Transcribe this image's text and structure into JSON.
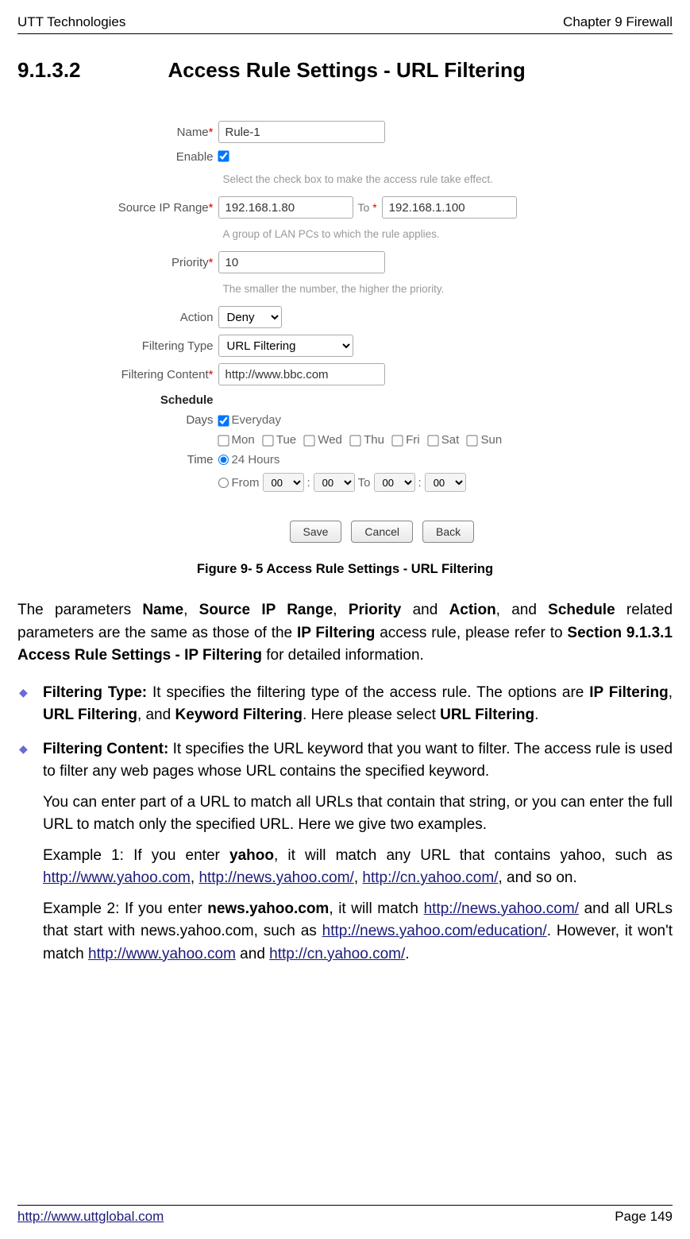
{
  "header": {
    "left": "UTT Technologies",
    "right": "Chapter 9 Firewall"
  },
  "section": {
    "num": "9.1.3.2",
    "title": "Access Rule Settings - URL Filtering"
  },
  "form": {
    "name_label": "Name",
    "name_value": "Rule-1",
    "enable_label": "Enable",
    "enable_hint": "Select the check box to make the access rule take effect.",
    "srcip_label": "Source IP Range",
    "srcip_from": "192.168.1.80",
    "srcip_to_label": "To",
    "srcip_to": "192.168.1.100",
    "srcip_hint": "A group of LAN PCs to which the rule applies.",
    "priority_label": "Priority",
    "priority_value": "10",
    "priority_hint": "The smaller the number, the higher the priority.",
    "action_label": "Action",
    "action_value": "Deny",
    "ftype_label": "Filtering Type",
    "ftype_value": "URL Filtering",
    "fcontent_label": "Filtering Content",
    "fcontent_value": "http://www.bbc.com",
    "schedule_label": "Schedule",
    "days_label": "Days",
    "day_every": "Everyday",
    "day_mon": "Mon",
    "day_tue": "Tue",
    "day_wed": "Wed",
    "day_thu": "Thu",
    "day_fri": "Fri",
    "day_sat": "Sat",
    "day_sun": "Sun",
    "time_label": "Time",
    "time_24": "24 Hours",
    "time_from": "From",
    "time_to": "To",
    "time_h1": "00",
    "time_m1": "00",
    "time_h2": "00",
    "time_m2": "00",
    "btn_save": "Save",
    "btn_cancel": "Cancel",
    "btn_back": "Back"
  },
  "figure_caption": "Figure 9- 5 Access Rule Settings - URL Filtering",
  "body": {
    "intro_1": "The parameters ",
    "intro_name": "Name",
    "intro_2": ", ",
    "intro_src": "Source IP Range",
    "intro_3": ", ",
    "intro_pri": "Priority",
    "intro_4": " and ",
    "intro_act": "Action",
    "intro_5": ", and ",
    "intro_sch": "Schedule",
    "intro_6": " related parameters are the same as those of the ",
    "intro_ipf": "IP Filtering",
    "intro_7": " access rule, please refer to ",
    "intro_sec": "Section 9.1.3.1 Access Rule Settings - IP Filtering",
    "intro_8": " for detailed information.",
    "b1_lead": "Filtering Type: ",
    "b1_a": "It specifies the filtering type of the access rule. The options are ",
    "b1_opt1": "IP Filtering",
    "b1_sep1": ", ",
    "b1_opt2": "URL Filtering",
    "b1_sep2": ", and ",
    "b1_opt3": "Keyword Filtering",
    "b1_b": ". Here please select ",
    "b1_sel": "URL Filtering",
    "b1_end": ".",
    "b2_lead": "Filtering Content: ",
    "b2_p1": "It specifies the URL keyword that you want to filter. The access rule is used to filter any web pages whose URL contains the specified keyword.",
    "b2_p2": "You can enter part of a URL to match all URLs that contain that string, or you can enter the full URL to match only the specified URL. Here we give two examples.",
    "ex1_a": "Example 1: If you enter ",
    "ex1_kw": "yahoo",
    "ex1_b": ", it will match any URL that contains yahoo, such as ",
    "ex1_u1": "http://www.yahoo.com",
    "ex1_c": ", ",
    "ex1_u2": "http://news.yahoo.com/",
    "ex1_d": ", ",
    "ex1_u3": "http://cn.yahoo.com/",
    "ex1_e": ", and so on.",
    "ex2_a": "Example 2: If you enter ",
    "ex2_kw": "news.yahoo.com",
    "ex2_b": ", it will match ",
    "ex2_u1": "http://news.yahoo.com/",
    "ex2_c": " and all URLs that start with news.yahoo.com, such as ",
    "ex2_u2": "http://news.yahoo.com/education/",
    "ex2_d": ". However, it won't match ",
    "ex2_u3": "http://www.yahoo.com",
    "ex2_e": " and ",
    "ex2_u4": "http://cn.yahoo.com/",
    "ex2_f": "."
  },
  "footer": {
    "url": "http://www.uttglobal.com",
    "page": "Page 149"
  }
}
